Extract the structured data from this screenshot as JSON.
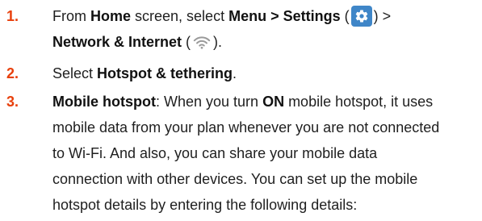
{
  "accent": "#e8400c",
  "settings_icon_bg": "#3f86c8",
  "steps": [
    {
      "number": "1.",
      "line1": {
        "t1": "From ",
        "b1": "Home",
        "t2": " screen, select ",
        "b2": "Menu > Settings",
        "t3": " (",
        "t4": ") >"
      },
      "line2": {
        "b1": "Network & Internet",
        "t1": " (",
        "t2": ")."
      }
    },
    {
      "number": "2.",
      "line1": {
        "t1": "Select ",
        "b1": "Hotspot & tethering",
        "t2": "."
      }
    },
    {
      "number": "3.",
      "line1": {
        "b1": "Mobile hotspot",
        "t1": ": When you turn ",
        "b2": "ON",
        "t2": " mobile hotspot, it uses"
      },
      "lines": [
        "mobile data from your plan whenever you are not connected",
        "to Wi-Fi. And also, you can share your mobile data",
        "connection with other devices. You can set up the mobile",
        "hotspot details by entering the following details:"
      ]
    }
  ]
}
